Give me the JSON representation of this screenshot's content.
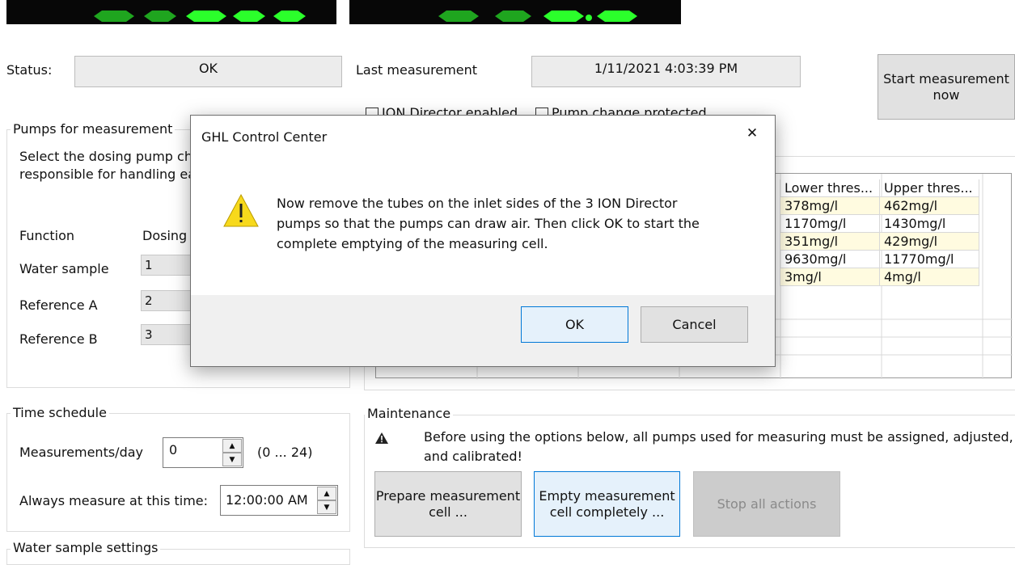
{
  "status": {
    "label": "Status:",
    "value": "OK"
  },
  "last_measurement": {
    "label": "Last measurement",
    "value": "1/11/2021 4:03:39 PM"
  },
  "start_button": {
    "line1": "Start measurement",
    "line2": "now"
  },
  "checkboxes": {
    "first_partial": "ION Director enabled",
    "second_partial": "Pump change protected"
  },
  "pumps": {
    "title": "Pumps for measurement",
    "desc_line1": "Select the dosing pump ch",
    "desc_line2": "responsible for handling ea",
    "col_function": "Function",
    "col_dosing": "Dosing",
    "rows": [
      {
        "label": "Water sample",
        "value": "1"
      },
      {
        "label": "Reference A",
        "value": "2"
      },
      {
        "label": "Reference B",
        "value": "3"
      }
    ]
  },
  "thresholds": {
    "header_lower": "Lower thres...",
    "header_upper": "Upper thres...",
    "rows": [
      {
        "lower": "378mg/l",
        "upper": "462mg/l"
      },
      {
        "lower": "1170mg/l",
        "upper": "1430mg/l"
      },
      {
        "lower": "351mg/l",
        "upper": "429mg/l"
      },
      {
        "lower": "9630mg/l",
        "upper": "11770mg/l"
      },
      {
        "lower": "3mg/l",
        "upper": "4mg/l"
      }
    ]
  },
  "schedule": {
    "title": "Time schedule",
    "per_day_label": "Measurements/day",
    "per_day_value": "0",
    "per_day_range": "(0 ... 24)",
    "always_label": "Always measure at this time:",
    "always_value": "12:00:00 AM"
  },
  "water_sample_settings": {
    "title": "Water sample settings"
  },
  "maintenance": {
    "title": "Maintenance",
    "warning_line1": "Before using the options below, all pumps used for measuring must be assigned, adjusted,",
    "warning_line2": "and calibrated!",
    "prepare_line1": "Prepare measurement",
    "prepare_line2": "cell ...",
    "empty_line1": "Empty measurement",
    "empty_line2": "cell completely ...",
    "stop": "Stop all actions"
  },
  "dialog": {
    "title": "GHL Control Center",
    "close": "✕",
    "message_line1": "Now remove the tubes on the inlet sides of the 3 ION Director",
    "message_line2": "pumps so that the pumps can draw air. Then click OK to start the",
    "message_line3": "complete emptying of the measuring cell.",
    "ok": "OK",
    "cancel": "Cancel"
  },
  "colors": {
    "led_green": "#2bff2b",
    "highlight_row": "#fffbe0",
    "focus_border": "#0078d7",
    "warning_yellow": "#f7d91c"
  }
}
